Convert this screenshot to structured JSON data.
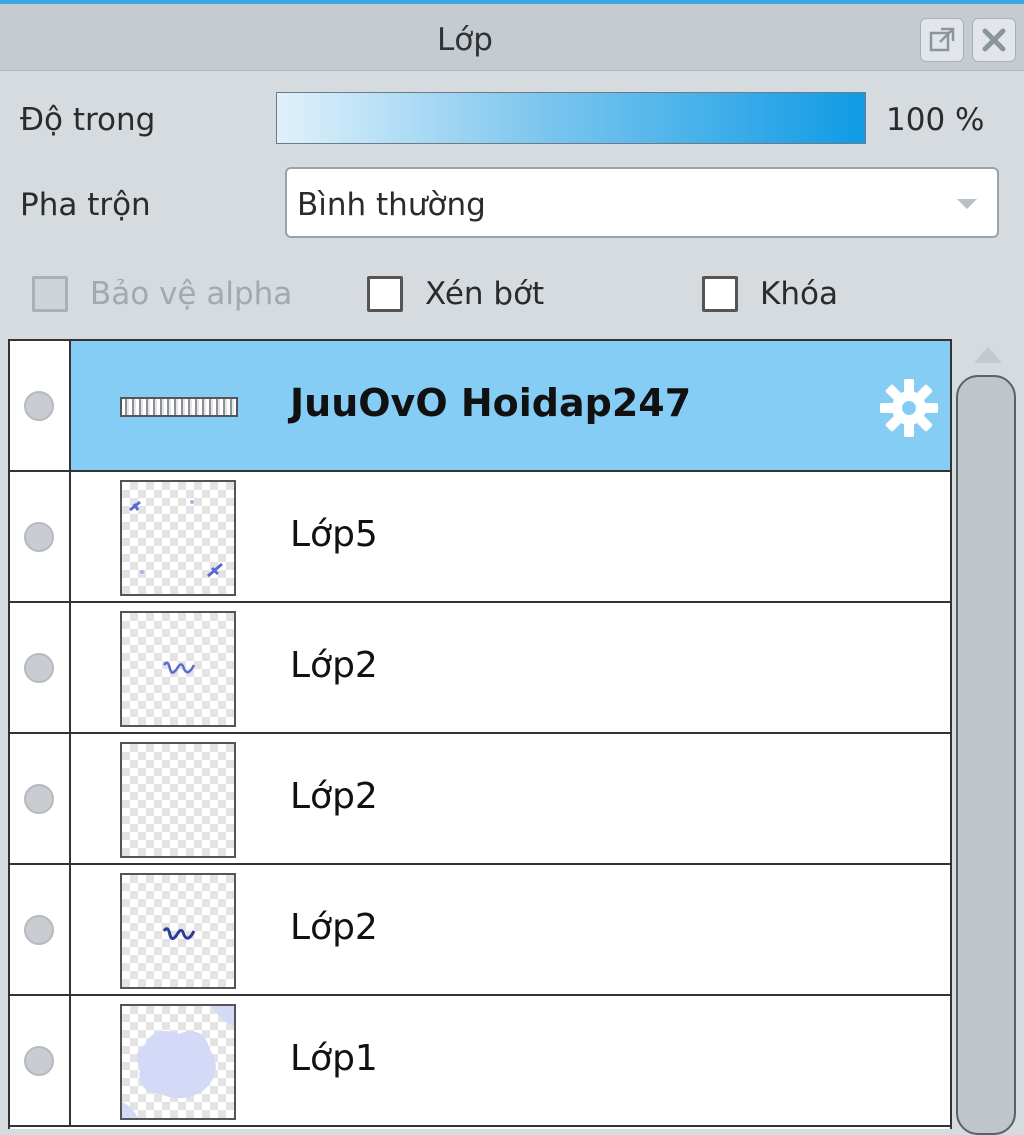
{
  "window": {
    "title": "Lớp",
    "icons": {
      "popout": "popout-icon",
      "close": "close-icon"
    }
  },
  "opacity": {
    "label": "Độ trong",
    "value": 100,
    "value_text": "100 %"
  },
  "blend": {
    "label": "Pha trộn",
    "selected": "Bình thường"
  },
  "options": {
    "protect_alpha": {
      "label": "Bảo vệ alpha",
      "checked": false,
      "disabled": true
    },
    "clipping": {
      "label": "Xén bớt",
      "checked": false
    },
    "lock": {
      "label": "Khóa",
      "checked": false
    }
  },
  "layers": [
    {
      "name": "JuuOvO Hoidap247",
      "type": "text",
      "selected": true,
      "icon": "gear-icon"
    },
    {
      "name": "Lớp5",
      "type": "raster"
    },
    {
      "name": "Lớp2",
      "type": "raster"
    },
    {
      "name": "Lớp2",
      "type": "raster"
    },
    {
      "name": "Lớp2",
      "type": "raster"
    },
    {
      "name": "Lớp1",
      "type": "raster"
    }
  ],
  "colors": {
    "accent": "#3aa7e4",
    "selected_row": "#86cdf5"
  }
}
